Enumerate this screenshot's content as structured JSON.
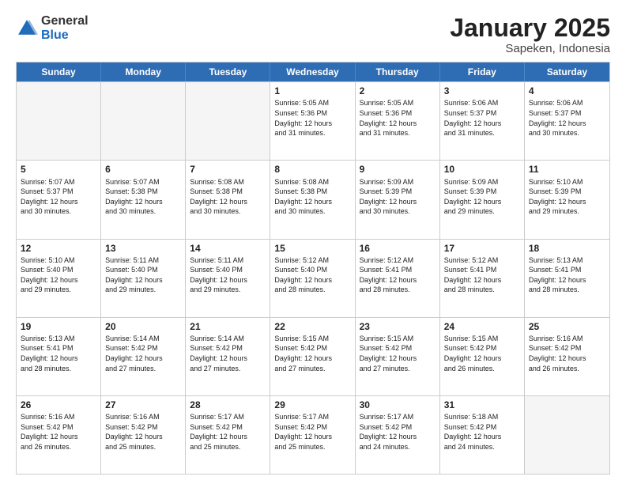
{
  "logo": {
    "general": "General",
    "blue": "Blue"
  },
  "title": {
    "main": "January 2025",
    "sub": "Sapeken, Indonesia"
  },
  "headers": [
    "Sunday",
    "Monday",
    "Tuesday",
    "Wednesday",
    "Thursday",
    "Friday",
    "Saturday"
  ],
  "weeks": [
    [
      {
        "day": "",
        "text": "",
        "empty": true
      },
      {
        "day": "",
        "text": "",
        "empty": true
      },
      {
        "day": "",
        "text": "",
        "empty": true
      },
      {
        "day": "1",
        "text": "Sunrise: 5:05 AM\nSunset: 5:36 PM\nDaylight: 12 hours\nand 31 minutes.",
        "empty": false
      },
      {
        "day": "2",
        "text": "Sunrise: 5:05 AM\nSunset: 5:36 PM\nDaylight: 12 hours\nand 31 minutes.",
        "empty": false
      },
      {
        "day": "3",
        "text": "Sunrise: 5:06 AM\nSunset: 5:37 PM\nDaylight: 12 hours\nand 31 minutes.",
        "empty": false
      },
      {
        "day": "4",
        "text": "Sunrise: 5:06 AM\nSunset: 5:37 PM\nDaylight: 12 hours\nand 30 minutes.",
        "empty": false
      }
    ],
    [
      {
        "day": "5",
        "text": "Sunrise: 5:07 AM\nSunset: 5:37 PM\nDaylight: 12 hours\nand 30 minutes.",
        "empty": false
      },
      {
        "day": "6",
        "text": "Sunrise: 5:07 AM\nSunset: 5:38 PM\nDaylight: 12 hours\nand 30 minutes.",
        "empty": false
      },
      {
        "day": "7",
        "text": "Sunrise: 5:08 AM\nSunset: 5:38 PM\nDaylight: 12 hours\nand 30 minutes.",
        "empty": false
      },
      {
        "day": "8",
        "text": "Sunrise: 5:08 AM\nSunset: 5:38 PM\nDaylight: 12 hours\nand 30 minutes.",
        "empty": false
      },
      {
        "day": "9",
        "text": "Sunrise: 5:09 AM\nSunset: 5:39 PM\nDaylight: 12 hours\nand 30 minutes.",
        "empty": false
      },
      {
        "day": "10",
        "text": "Sunrise: 5:09 AM\nSunset: 5:39 PM\nDaylight: 12 hours\nand 29 minutes.",
        "empty": false
      },
      {
        "day": "11",
        "text": "Sunrise: 5:10 AM\nSunset: 5:39 PM\nDaylight: 12 hours\nand 29 minutes.",
        "empty": false
      }
    ],
    [
      {
        "day": "12",
        "text": "Sunrise: 5:10 AM\nSunset: 5:40 PM\nDaylight: 12 hours\nand 29 minutes.",
        "empty": false
      },
      {
        "day": "13",
        "text": "Sunrise: 5:11 AM\nSunset: 5:40 PM\nDaylight: 12 hours\nand 29 minutes.",
        "empty": false
      },
      {
        "day": "14",
        "text": "Sunrise: 5:11 AM\nSunset: 5:40 PM\nDaylight: 12 hours\nand 29 minutes.",
        "empty": false
      },
      {
        "day": "15",
        "text": "Sunrise: 5:12 AM\nSunset: 5:40 PM\nDaylight: 12 hours\nand 28 minutes.",
        "empty": false
      },
      {
        "day": "16",
        "text": "Sunrise: 5:12 AM\nSunset: 5:41 PM\nDaylight: 12 hours\nand 28 minutes.",
        "empty": false
      },
      {
        "day": "17",
        "text": "Sunrise: 5:12 AM\nSunset: 5:41 PM\nDaylight: 12 hours\nand 28 minutes.",
        "empty": false
      },
      {
        "day": "18",
        "text": "Sunrise: 5:13 AM\nSunset: 5:41 PM\nDaylight: 12 hours\nand 28 minutes.",
        "empty": false
      }
    ],
    [
      {
        "day": "19",
        "text": "Sunrise: 5:13 AM\nSunset: 5:41 PM\nDaylight: 12 hours\nand 28 minutes.",
        "empty": false
      },
      {
        "day": "20",
        "text": "Sunrise: 5:14 AM\nSunset: 5:42 PM\nDaylight: 12 hours\nand 27 minutes.",
        "empty": false
      },
      {
        "day": "21",
        "text": "Sunrise: 5:14 AM\nSunset: 5:42 PM\nDaylight: 12 hours\nand 27 minutes.",
        "empty": false
      },
      {
        "day": "22",
        "text": "Sunrise: 5:15 AM\nSunset: 5:42 PM\nDaylight: 12 hours\nand 27 minutes.",
        "empty": false
      },
      {
        "day": "23",
        "text": "Sunrise: 5:15 AM\nSunset: 5:42 PM\nDaylight: 12 hours\nand 27 minutes.",
        "empty": false
      },
      {
        "day": "24",
        "text": "Sunrise: 5:15 AM\nSunset: 5:42 PM\nDaylight: 12 hours\nand 26 minutes.",
        "empty": false
      },
      {
        "day": "25",
        "text": "Sunrise: 5:16 AM\nSunset: 5:42 PM\nDaylight: 12 hours\nand 26 minutes.",
        "empty": false
      }
    ],
    [
      {
        "day": "26",
        "text": "Sunrise: 5:16 AM\nSunset: 5:42 PM\nDaylight: 12 hours\nand 26 minutes.",
        "empty": false
      },
      {
        "day": "27",
        "text": "Sunrise: 5:16 AM\nSunset: 5:42 PM\nDaylight: 12 hours\nand 25 minutes.",
        "empty": false
      },
      {
        "day": "28",
        "text": "Sunrise: 5:17 AM\nSunset: 5:42 PM\nDaylight: 12 hours\nand 25 minutes.",
        "empty": false
      },
      {
        "day": "29",
        "text": "Sunrise: 5:17 AM\nSunset: 5:42 PM\nDaylight: 12 hours\nand 25 minutes.",
        "empty": false
      },
      {
        "day": "30",
        "text": "Sunrise: 5:17 AM\nSunset: 5:42 PM\nDaylight: 12 hours\nand 24 minutes.",
        "empty": false
      },
      {
        "day": "31",
        "text": "Sunrise: 5:18 AM\nSunset: 5:42 PM\nDaylight: 12 hours\nand 24 minutes.",
        "empty": false
      },
      {
        "day": "",
        "text": "",
        "empty": true
      }
    ]
  ]
}
